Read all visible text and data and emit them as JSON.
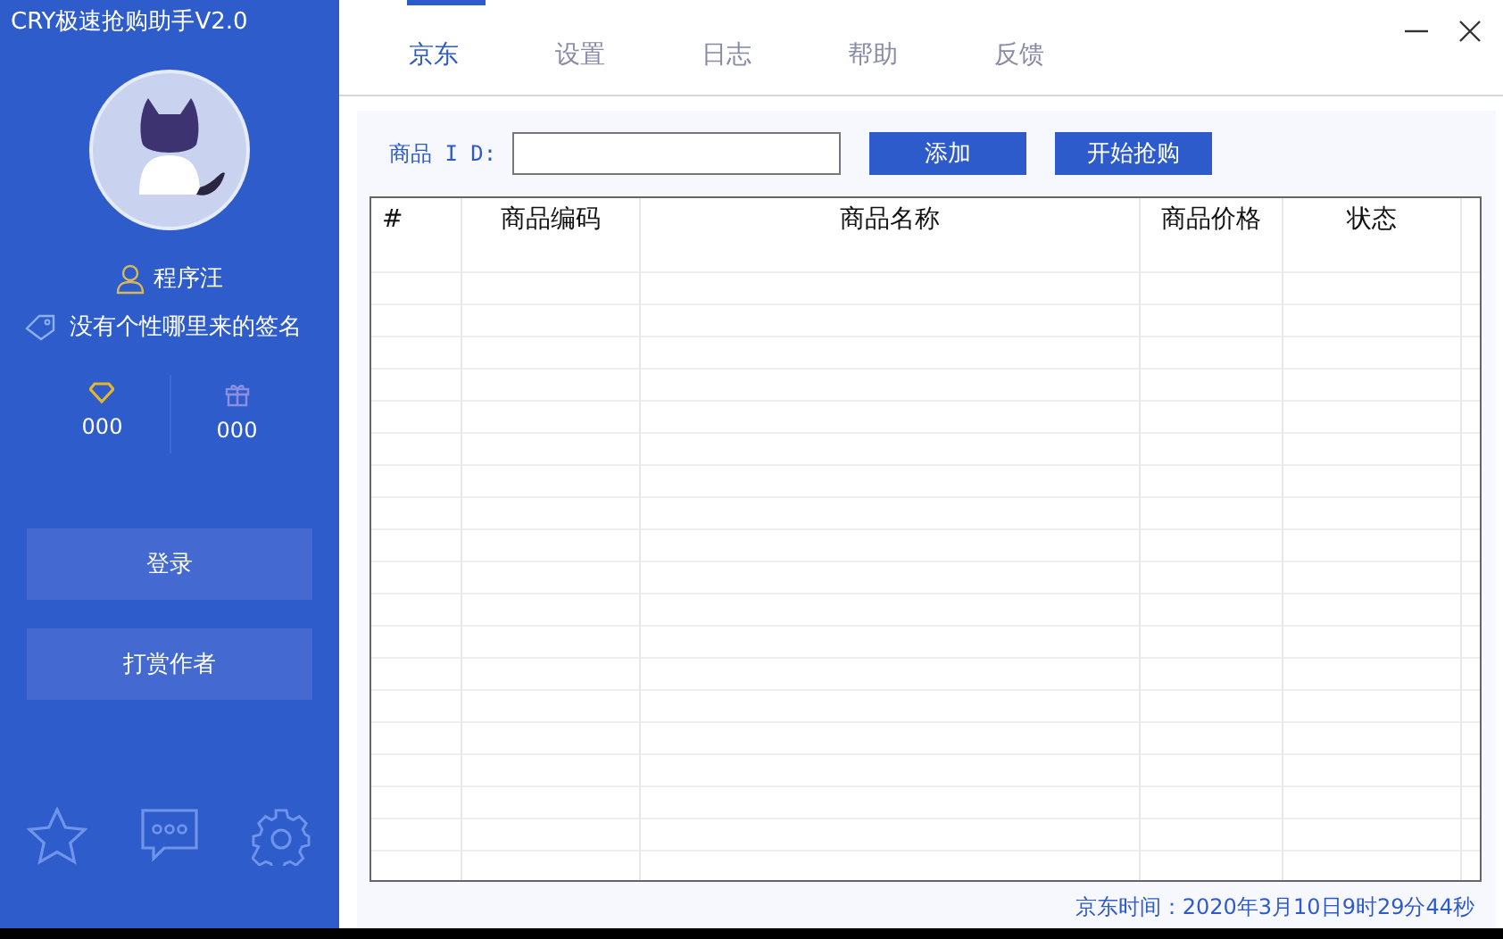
{
  "window": {
    "title": "CRY极速抢购助手V2.0"
  },
  "profile": {
    "name": "程序汪",
    "signature": "没有个性哪里来的签名",
    "stats": [
      {
        "kind": "diamond",
        "value": "000"
      },
      {
        "kind": "gift",
        "value": "000"
      }
    ]
  },
  "sidebar_buttons": [
    "登录",
    "打赏作者"
  ],
  "tabs": [
    {
      "label": "京东",
      "selected": true
    },
    {
      "label": "设置",
      "selected": false
    },
    {
      "label": "日志",
      "selected": false
    },
    {
      "label": "帮助",
      "selected": false
    },
    {
      "label": "反馈",
      "selected": false
    }
  ],
  "product_id": {
    "label": "商品 I D:"
  },
  "buttons": [
    "添加",
    "开始抢购"
  ],
  "table": {
    "columns": [
      "#",
      "商品编码",
      "商品名称",
      "商品价格",
      "状态"
    ]
  },
  "status_bar": {
    "text": "京东时间：2020年3月10日9时29分44秒"
  }
}
